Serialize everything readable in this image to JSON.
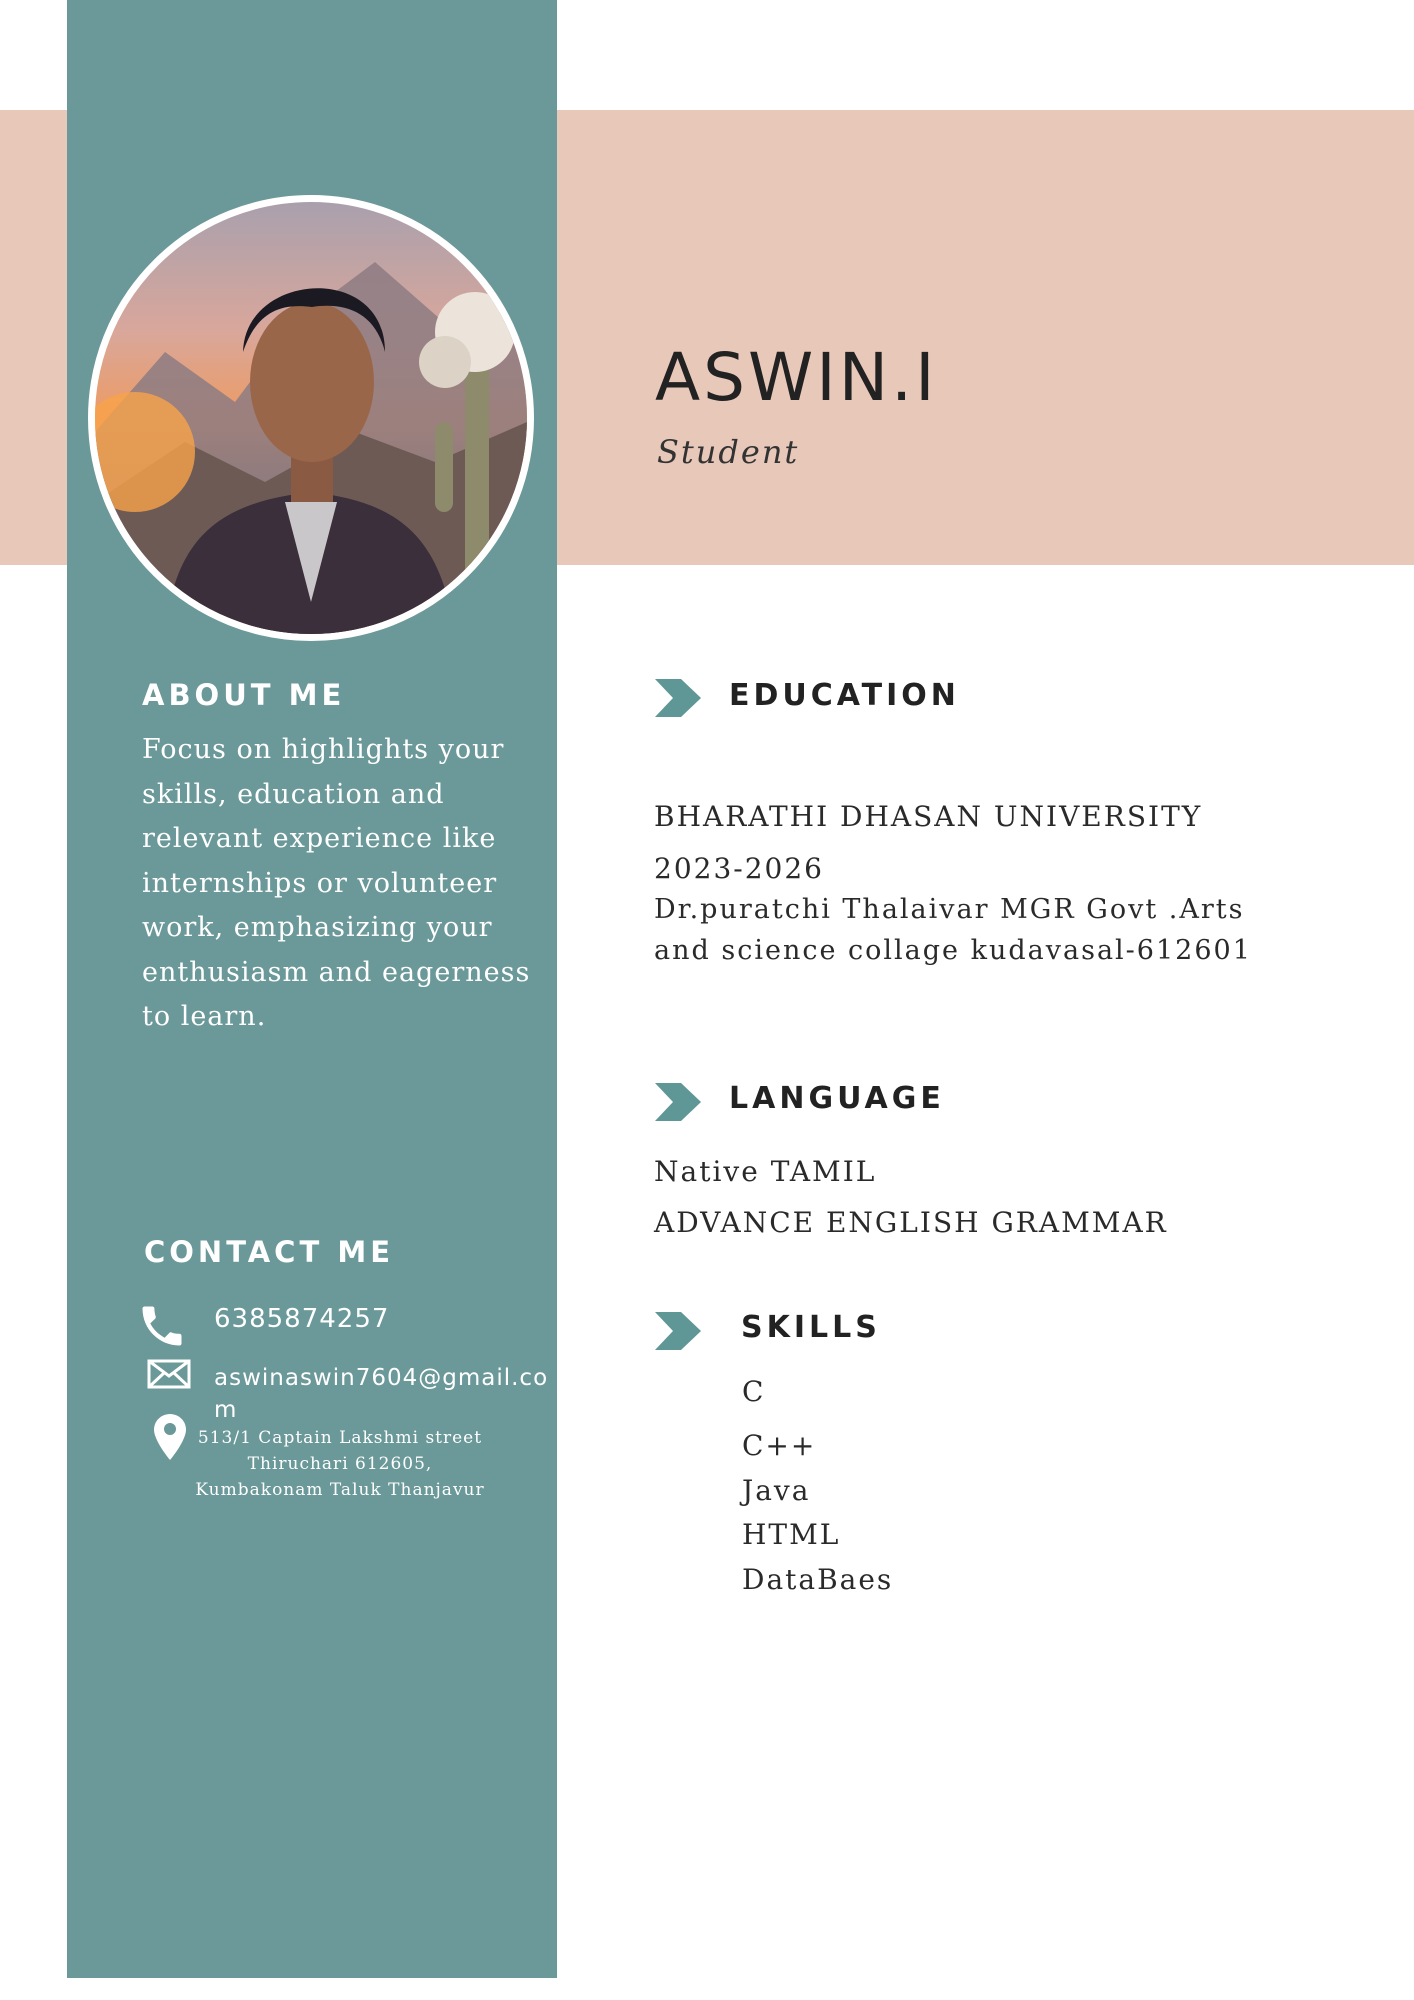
{
  "profile": {
    "name": "ASWIN.I",
    "role": "Student"
  },
  "about": {
    "heading": "ABOUT ME",
    "text": "Focus on highlights your skills, education and relevant experience like internships or volunteer work, emphasizing your enthusiasm and eagerness to learn."
  },
  "contact": {
    "heading": "CONTACT ME",
    "phone": "6385874257",
    "email": "aswinaswin7604@gmail.com",
    "address": "513/1 Captain Lakshmi street Thiruchari 612605, Kumbakonam Taluk Thanjavur",
    "phone_icon": "phone-icon",
    "email_icon": "envelope-icon",
    "address_icon": "map-pin-icon"
  },
  "education": {
    "heading": "EDUCATION",
    "university": "BHARATHI DHASAN UNIVERSITY",
    "years": "2023-2026",
    "college": "Dr.puratchi Thalaivar MGR Govt .Arts and science collage kudavasal-612601"
  },
  "language": {
    "heading": "LANGUAGE",
    "items": [
      "Native TAMIL",
      "ADVANCE ENGLISH GRAMMAR"
    ]
  },
  "skills": {
    "heading": "SKILLS",
    "items": [
      "C",
      "C++",
      "Java",
      "HTML",
      "DataBaes"
    ]
  },
  "colors": {
    "sidebar": "#6b9898",
    "header_band": "#e8c8b9",
    "accent_chevron": "#5f9696",
    "text_dark": "#222222"
  }
}
